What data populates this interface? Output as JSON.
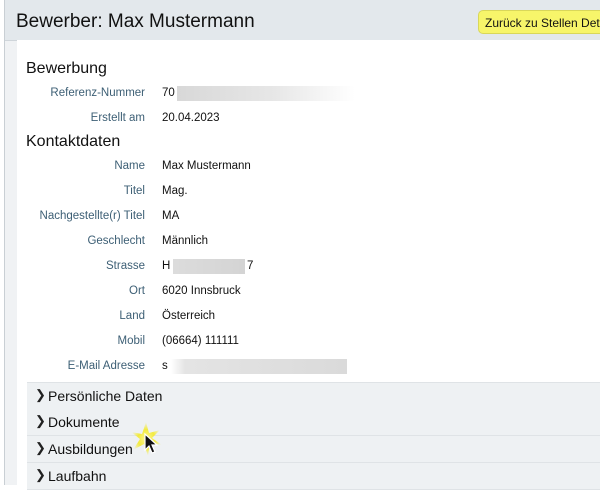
{
  "header": {
    "title": "Bewerber: Max Mustermann",
    "back_label": "Zurück zu Stellen Details"
  },
  "bewerbung": {
    "title": "Bewerbung",
    "fields": [
      {
        "label": "Referenz-Nummer",
        "value": "70"
      },
      {
        "label": "Erstellt am",
        "value": "20.04.2023"
      }
    ]
  },
  "kontakt": {
    "title": "Kontaktdaten",
    "fields": [
      {
        "label": "Name",
        "value": "Max Mustermann"
      },
      {
        "label": "Titel",
        "value": "Mag."
      },
      {
        "label": "Nachgestellte(r) Titel",
        "value": "MA"
      },
      {
        "label": "Geschlecht",
        "value": "Männlich"
      },
      {
        "label": "Strasse",
        "value": "H",
        "value_suffix": "7"
      },
      {
        "label": "Ort",
        "value": "6020 Innsbruck"
      },
      {
        "label": "Land",
        "value": "Österreich"
      },
      {
        "label": "Mobil",
        "value": "(06664) 111111"
      },
      {
        "label": "E-Mail Adresse",
        "value": "s"
      }
    ]
  },
  "accordions": [
    {
      "label": "Persönliche Daten"
    },
    {
      "label": "Dokumente"
    },
    {
      "label": "Ausbildungen"
    },
    {
      "label": "Laufbahn"
    }
  ],
  "icons": {
    "chevron": "chevron-right-icon",
    "cursor": "mouse-pointer-icon"
  },
  "colors": {
    "label": "#3d5f75",
    "back_button": "#f7f56a",
    "header_bg": "#e3e8ec",
    "accordion_bg": "#eef1f3"
  }
}
